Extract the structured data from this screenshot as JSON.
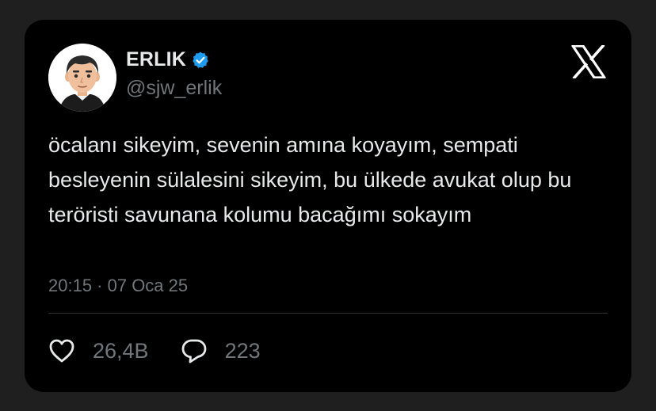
{
  "author": {
    "display_name": "ERLIK",
    "handle": "@sjw_erlik",
    "verified": true,
    "verified_color": "#1d9bf0",
    "avatar_icon": "avatar-illustration"
  },
  "platform_icon": "x-logo",
  "tweet": {
    "text": "öcalanı sikeyim, sevenin amına koyayım, sempati besleyenin sülalesini sikeyim, bu ülkede avukat olup bu teröristi savunana kolumu bacağımı sokayım",
    "timestamp": "20:15 · 07 Oca 25"
  },
  "actions": {
    "likes": {
      "icon": "heart-icon",
      "count": "26,4B"
    },
    "replies": {
      "icon": "reply-icon",
      "count": "223"
    }
  },
  "colors": {
    "background": "#1f1f1f",
    "card": "#000000",
    "text": "#e7e9ea",
    "muted": "#71767b",
    "divider": "#2f3336"
  }
}
